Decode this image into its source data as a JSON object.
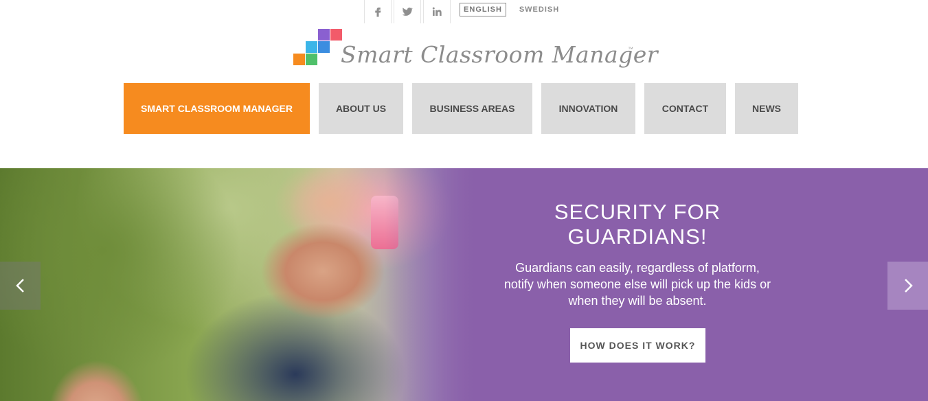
{
  "topbar": {
    "social": [
      {
        "icon": "facebook-icon",
        "glyph": "f"
      },
      {
        "icon": "twitter-icon",
        "glyph": "t"
      },
      {
        "icon": "linkedin-icon",
        "glyph": "in"
      }
    ],
    "languages": [
      "ENGLISH",
      "SWEDISH"
    ],
    "active_language": "ENGLISH"
  },
  "logo": {
    "text": "Smart Classroom Manager",
    "tm": "™",
    "colors": [
      "#f68b1f",
      "#3bb5e8",
      "#8a60d0",
      "#f25b6a",
      "#4fc06a",
      "#3b8de0"
    ]
  },
  "nav": {
    "items": [
      {
        "label": "SMART CLASSROOM MANAGER",
        "active": true
      },
      {
        "label": "ABOUT US",
        "active": false
      },
      {
        "label": "BUSINESS AREAS",
        "active": false
      },
      {
        "label": "INNOVATION",
        "active": false
      },
      {
        "label": "CONTACT",
        "active": false
      },
      {
        "label": "NEWS",
        "active": false
      }
    ],
    "accent": "#f68b1f"
  },
  "hero": {
    "title": "SECURITY FOR GUARDIANS!",
    "text": "Guardians can easily, regardless of platform, notify when someone else will pick up the kids or when they will be absent.",
    "button": "HOW DOES IT WORK?",
    "background": "#8a60aa",
    "prev_icon": "chevron-left-icon",
    "next_icon": "chevron-right-icon"
  }
}
